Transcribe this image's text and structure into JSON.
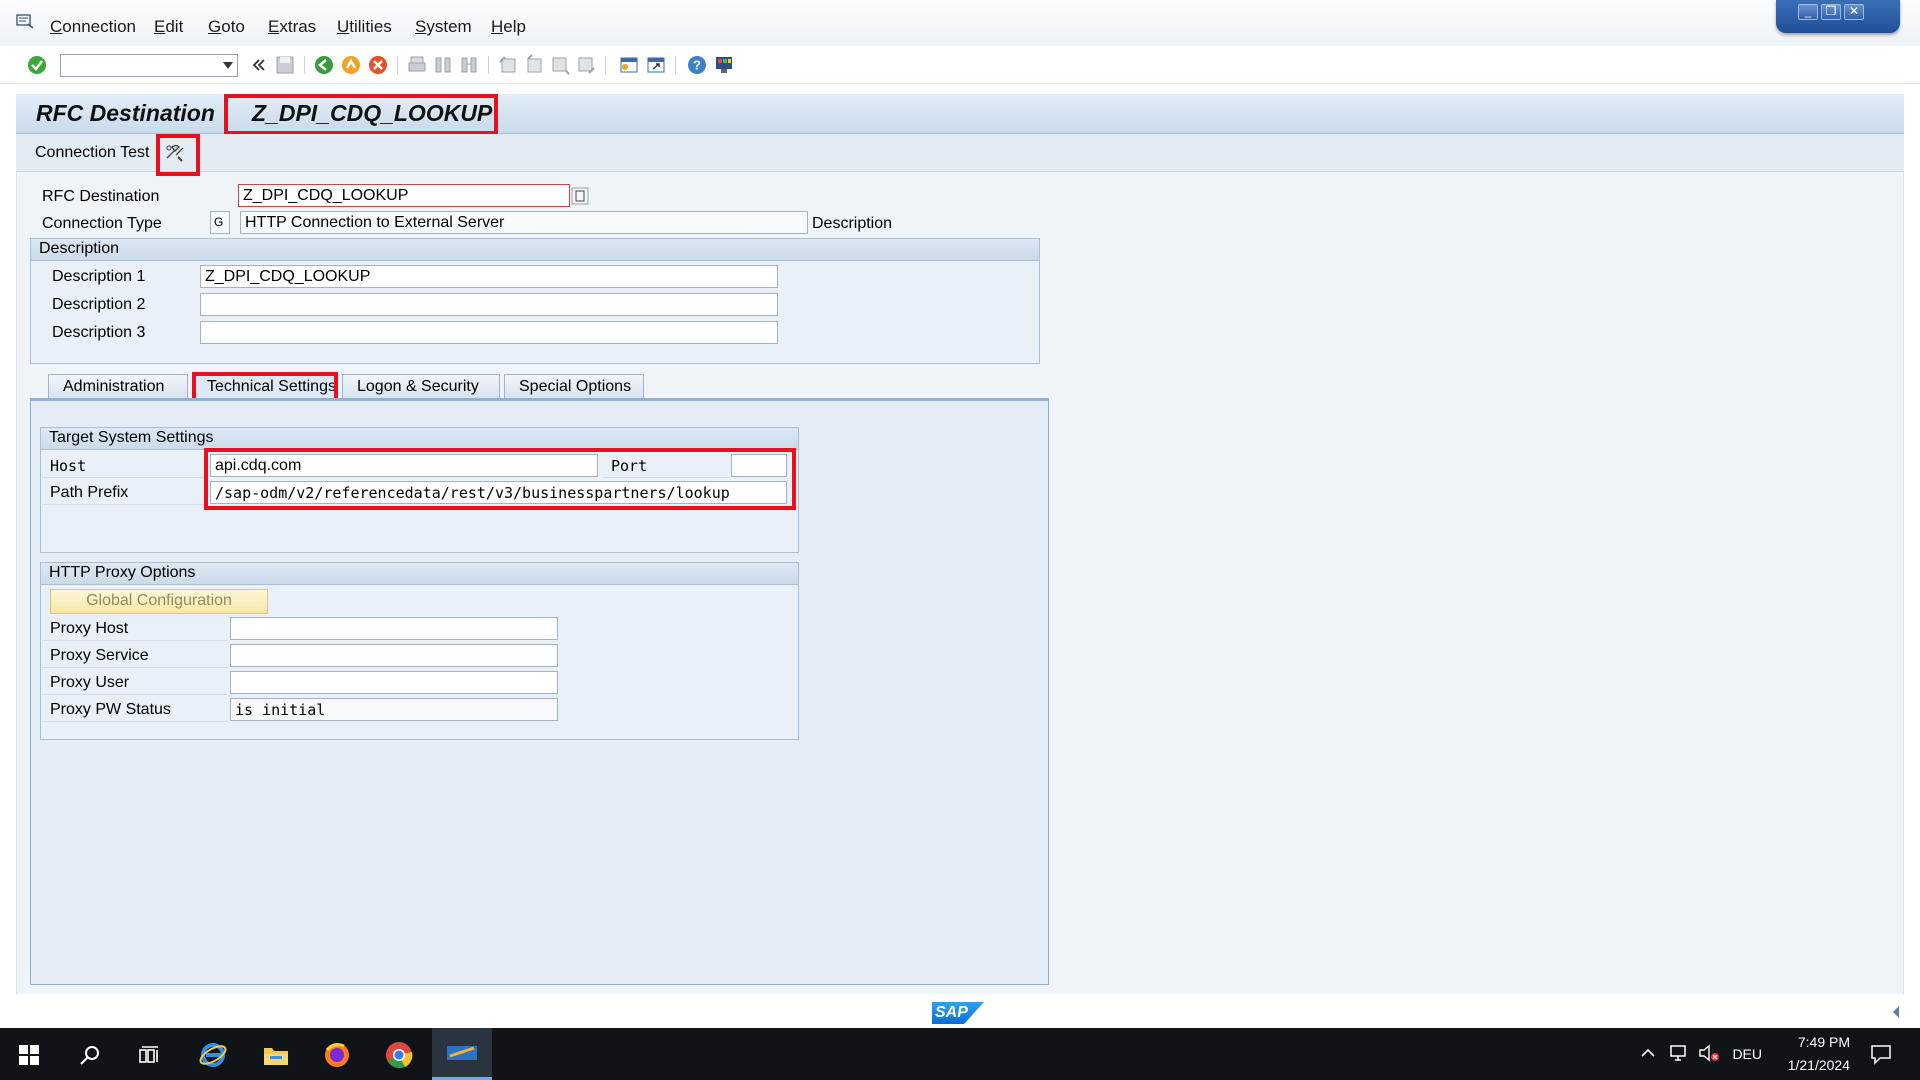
{
  "menu": {
    "items": [
      "Connection",
      "Edit",
      "Goto",
      "Extras",
      "Utilities",
      "System",
      "Help"
    ]
  },
  "window_controls": {
    "minimize": "_",
    "restore": "❐",
    "close": "✕"
  },
  "header": {
    "title_prefix": "RFC Destination",
    "title_destination": "Z_DPI_CDQ_LOOKUP"
  },
  "appbar": {
    "connection_test_label": "Connection Test"
  },
  "form": {
    "rfc_destination_label": "RFC Destination",
    "rfc_destination_value": "Z_DPI_CDQ_LOOKUP",
    "connection_type_label": "Connection Type",
    "connection_type_code": "G",
    "connection_type_text": "HTTP Connection to External Server",
    "description_side_label": "Description"
  },
  "description_group": {
    "title": "Description",
    "rows": [
      {
        "label": "Description 1",
        "value": "Z_DPI_CDQ_LOOKUP"
      },
      {
        "label": "Description 2",
        "value": ""
      },
      {
        "label": "Description 3",
        "value": ""
      }
    ]
  },
  "tabs": [
    {
      "label": "Administration",
      "active": false
    },
    {
      "label": "Technical Settings",
      "active": true
    },
    {
      "label": "Logon & Security",
      "active": false
    },
    {
      "label": "Special Options",
      "active": false
    }
  ],
  "target_system": {
    "title": "Target System Settings",
    "host_label": "Host",
    "host_value": "api.cdq.com",
    "port_label": "Port",
    "port_value": "",
    "path_prefix_label": "Path Prefix",
    "path_prefix_value": "/sap-odm/v2/referencedata/rest/v3/businesspartners/lookup"
  },
  "proxy": {
    "title": "HTTP Proxy Options",
    "global_config_button": "Global Configuration",
    "rows": [
      {
        "label": "Proxy Host",
        "value": ""
      },
      {
        "label": "Proxy Service",
        "value": ""
      },
      {
        "label": "Proxy User",
        "value": ""
      },
      {
        "label": "Proxy PW Status",
        "value": "is initial"
      }
    ]
  },
  "footer": {
    "sap_logo_text": "SAP"
  },
  "tray": {
    "language": "DEU",
    "time": "7:49 PM",
    "date": "1/21/2024"
  },
  "colors": {
    "highlight": "#e8101c",
    "title_bar": "#c9daeb",
    "taskbar": "#101418"
  }
}
